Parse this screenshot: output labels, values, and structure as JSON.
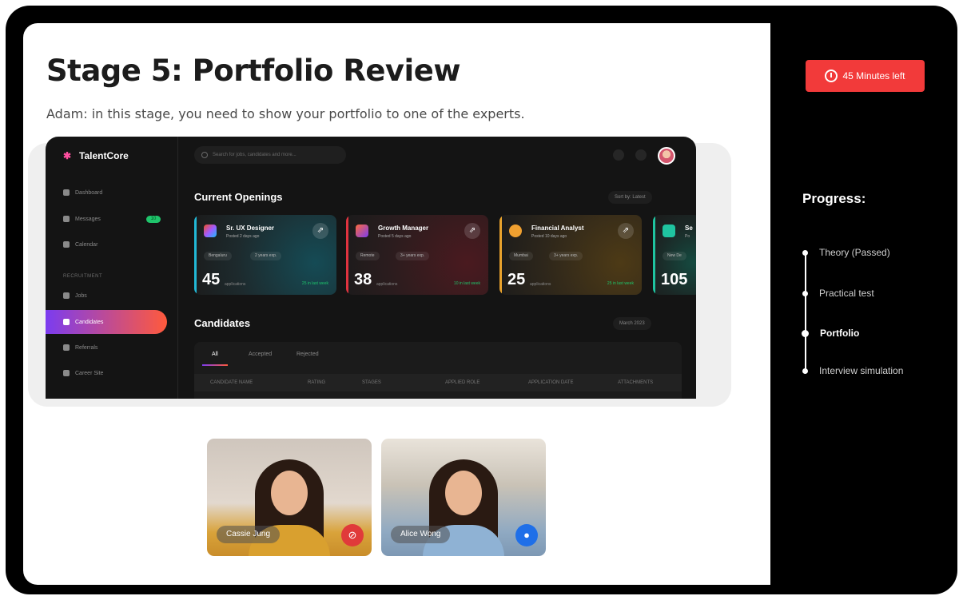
{
  "stage": {
    "title": "Stage 5: Portfolio Review",
    "subtitle": "Adam: in this stage, you need to show your portfolio to one of the experts."
  },
  "dashboard": {
    "app_name": "TalentCore",
    "search_placeholder": "Search for jobs, candidates and more...",
    "nav": [
      {
        "label": "Dashboard",
        "icon": "grid-icon"
      },
      {
        "label": "Messages",
        "icon": "chat-icon",
        "badge": "10"
      },
      {
        "label": "Calendar",
        "icon": "calendar-icon"
      }
    ],
    "section_label": "RECRUITMENT",
    "nav2": [
      {
        "label": "Jobs",
        "icon": "briefcase-icon"
      },
      {
        "label": "Candidates",
        "icon": "users-icon",
        "active": true
      },
      {
        "label": "Referrals",
        "icon": "referral-icon"
      },
      {
        "label": "Career Site",
        "icon": "globe-icon"
      }
    ],
    "openings_title": "Current Openings",
    "openings_sort": "Sort by: Latest",
    "jobs": [
      {
        "title": "Sr. UX Designer",
        "posted": "Posted 2 days ago",
        "location": "Bengaluru",
        "experience": "2 years exp.",
        "count": "45",
        "count_label": "applications",
        "new": "25 in last week",
        "accent": "#22b8d6"
      },
      {
        "title": "Growth Manager",
        "posted": "Posted 5 days ago",
        "location": "Remote",
        "experience": "3+ years exp.",
        "count": "38",
        "count_label": "applications",
        "new": "10 in last week",
        "accent": "#e0333f"
      },
      {
        "title": "Financial Analyst",
        "posted": "Posted 10 days ago",
        "location": "Mumbai",
        "experience": "3+ years exp.",
        "count": "25",
        "count_label": "applications",
        "new": "25 in last week",
        "accent": "#e8a22d"
      },
      {
        "title": "Se",
        "posted": "Po",
        "location": "New De",
        "experience": "",
        "count": "105",
        "count_label": "",
        "new": "",
        "accent": "#1fc4a0"
      }
    ],
    "candidates_title": "Candidates",
    "candidates_filter": "March 2023",
    "tabs": [
      "All",
      "Accepted",
      "Rejected"
    ],
    "columns": [
      "CANDIDATE NAME",
      "RATING",
      "STAGES",
      "APPLIED ROLE",
      "APPLICATION DATE",
      "ATTACHMENTS"
    ]
  },
  "participants": [
    {
      "name": "Cassie Jung",
      "mic": "muted",
      "mic_color": "#e03a3a"
    },
    {
      "name": "Alice Wong",
      "mic": "active",
      "mic_color": "#1f6fe8"
    }
  ],
  "timer": {
    "label": "45 Minutes left"
  },
  "progress": {
    "title": "Progress:",
    "steps": [
      {
        "label": "Theory (Passed)"
      },
      {
        "label": "Practical test"
      },
      {
        "label": "Portfolio",
        "current": true
      },
      {
        "label": "Interview simulation"
      }
    ]
  }
}
